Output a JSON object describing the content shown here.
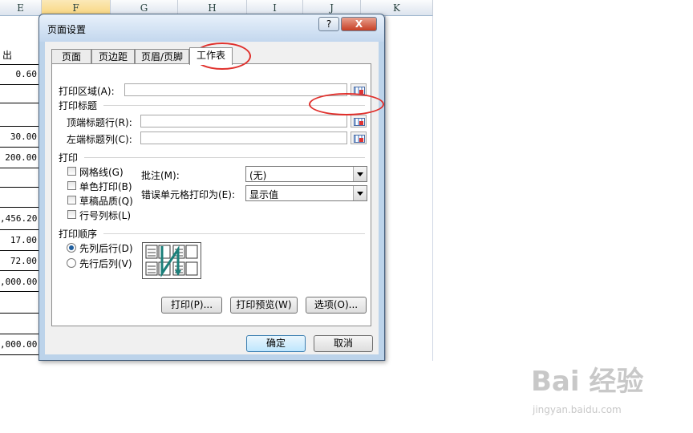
{
  "sheet": {
    "columns": [
      "E",
      "F",
      "G",
      "H",
      "I",
      "J",
      "K"
    ],
    "selected_column": "F",
    "cells": [
      "出",
      "0.60",
      "30.00",
      "200.00",
      ",456.20",
      "17.00",
      "72.00",
      ",000.00",
      ",000.00"
    ]
  },
  "dialog": {
    "title": "页面设置",
    "help_glyph": "?",
    "close_glyph": "X",
    "tabs": [
      "页面",
      "页边距",
      "页眉/页脚",
      "工作表"
    ],
    "active_tab": "工作表",
    "print_area_label": "打印区域(A):",
    "print_titles_header": "打印标题",
    "rows_repeat_label": "顶端标题行(R):",
    "cols_repeat_label": "左端标题列(C):",
    "print_header": "打印",
    "gridlines_label": "网格线(G)",
    "bw_label": "单色打印(B)",
    "draft_label": "草稿品质(Q)",
    "rowcol_label": "行号列标(L)",
    "comments_label": "批注(M):",
    "comments_value": "(无)",
    "errors_label": "错误单元格打印为(E):",
    "errors_value": "显示值",
    "page_order_header": "打印顺序",
    "down_over_label": "先列后行(D)",
    "over_down_label": "先行后列(V)",
    "page_order_selected": "先列后行(D)",
    "print_button": "打印(P)...",
    "preview_button": "打印预览(W)",
    "options_button": "选项(O)...",
    "ok_button": "确定",
    "cancel_button": "取消"
  },
  "watermark": {
    "brand": "Bai 经验",
    "url": "jingyan.baidu.com"
  },
  "colors": {
    "annotation": "#e0302c",
    "selected_column": "#f8d57e"
  }
}
